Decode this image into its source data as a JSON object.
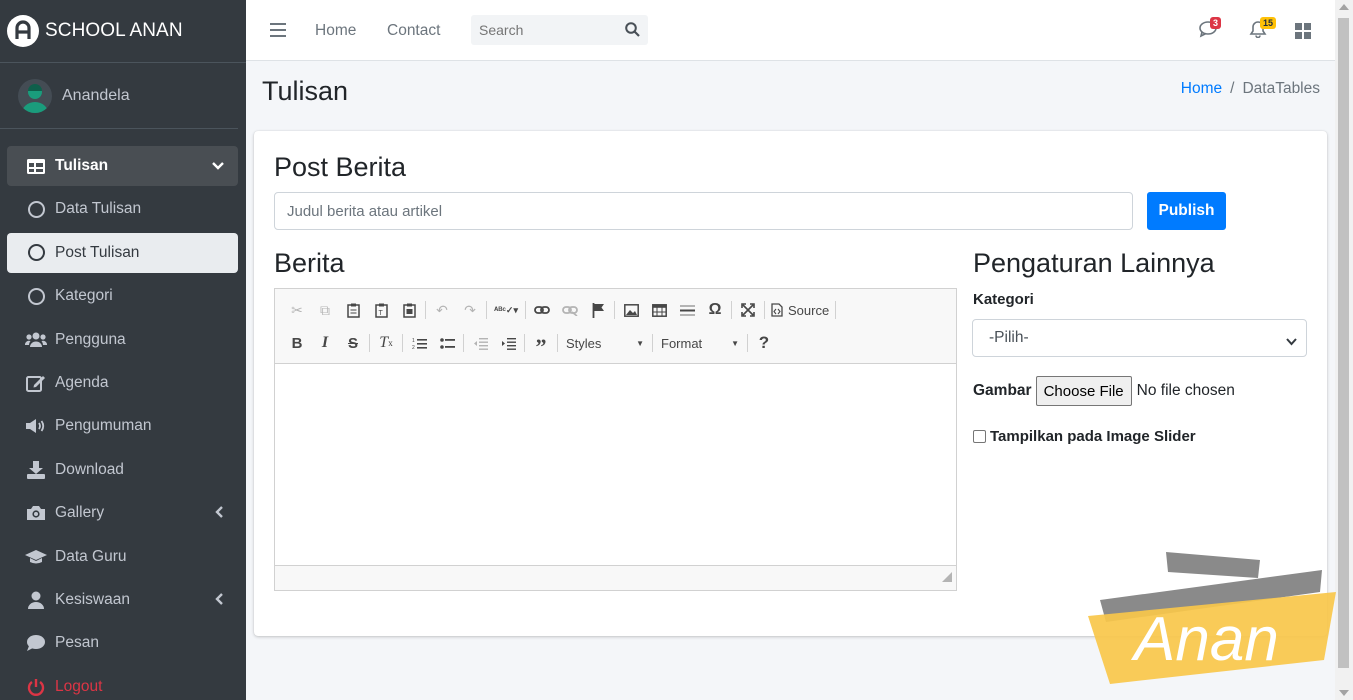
{
  "brand": {
    "title": "SCHOOL ANAN"
  },
  "user": {
    "name": "Anandela"
  },
  "sidebar": {
    "items": [
      {
        "label": "Tulisan",
        "icon": "table-icon"
      },
      {
        "label": "Data Tulisan",
        "icon": "circle-icon"
      },
      {
        "label": "Post Tulisan",
        "icon": "circle-icon"
      },
      {
        "label": "Kategori",
        "icon": "circle-icon"
      },
      {
        "label": "Pengguna",
        "icon": "users-icon"
      },
      {
        "label": "Agenda",
        "icon": "edit-icon"
      },
      {
        "label": "Pengumuman",
        "icon": "megaphone-icon"
      },
      {
        "label": "Download",
        "icon": "download-icon"
      },
      {
        "label": "Gallery",
        "icon": "camera-icon"
      },
      {
        "label": "Data Guru",
        "icon": "graduation-cap-icon"
      },
      {
        "label": "Kesiswaan",
        "icon": "user-icon"
      },
      {
        "label": "Pesan",
        "icon": "comment-icon"
      },
      {
        "label": "Logout",
        "icon": "power-icon"
      }
    ]
  },
  "topbar": {
    "home": "Home",
    "contact": "Contact",
    "search_placeholder": "Search",
    "messages_count": "3",
    "notifications_count": "15"
  },
  "page": {
    "title": "Tulisan",
    "breadcrumb": {
      "home": "Home",
      "current": "DataTables"
    }
  },
  "form": {
    "heading": "Post Berita",
    "title_placeholder": "Judul berita atau artikel",
    "publish": "Publish",
    "berita_heading": "Berita",
    "settings_heading": "Pengaturan Lainnya",
    "kategori_label": "Kategori",
    "kategori_value": "-Pilih-",
    "gambar_label": "Gambar",
    "choose_file": "Choose File",
    "no_file": "No file chosen",
    "slider_label": "Tampilkan pada Image Slider"
  },
  "editor": {
    "source_label": "Source",
    "styles_label": "Styles",
    "format_label": "Format",
    "help_label": "?"
  },
  "watermark": {
    "text": "Anan"
  },
  "colors": {
    "sidebar_bg": "#343a40",
    "primary": "#007bff",
    "danger": "#dc3545",
    "warning": "#ffc107",
    "watermark_gold": "#f8c74a",
    "watermark_gray": "#8a8a8a"
  }
}
